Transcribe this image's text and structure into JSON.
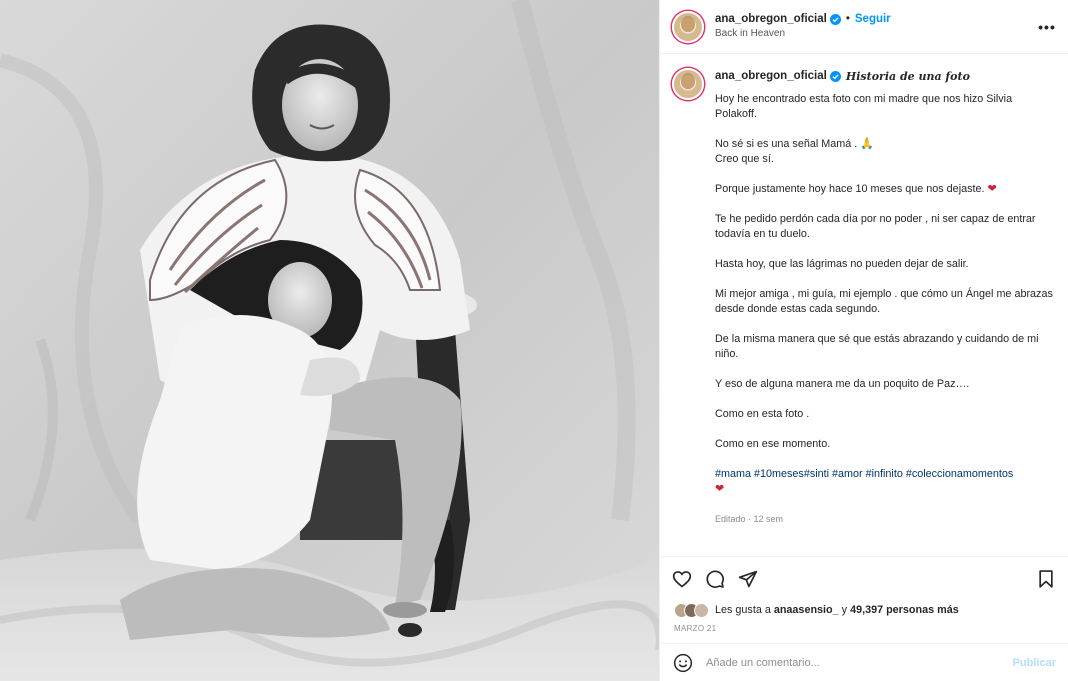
{
  "header": {
    "username": "ana_obregon_oficial",
    "follow_label": "Seguir",
    "dot": "•",
    "location": "Back in Heaven",
    "more_label": "•••"
  },
  "caption": {
    "username": "ana_obregon_oficial",
    "title": "Historia de una foto",
    "paragraphs": [
      "Hoy he encontrado esta foto con mi madre que nos hizo Silvia Polakoff.",
      "No sé si es una señal Mamá .",
      "Creo que sí.",
      "Porque justamente hoy hace 10 meses que nos dejaste.",
      "Te he pedido perdón cada día por no poder , ni ser capaz de entrar todavía en tu duelo.",
      "Hasta hoy, que las lágrimas no pueden dejar de salir.",
      "Mi mejor amiga , mi guía, mi ejemplo . que cómo un Ángel me abrazas desde donde estas cada segundo.",
      "De la misma manera que sé que estás abrazando y cuidando de mi niño.",
      "Y eso de alguna manera me da un poquito de Paz….",
      "Como en esta foto .",
      "Como en ese momento."
    ],
    "pray_emoji": "🙏",
    "heart": "❤",
    "hashtags": "#mama #10meses#sinti #amor #infinito #coleccionamomentos",
    "edited": "Editado · 12 sem"
  },
  "likes": {
    "prefix": "Les gusta a",
    "user": "anaasensio_",
    "middle": "y",
    "count": "49,397 personas más"
  },
  "date": "MARZO 21",
  "comment": {
    "placeholder": "Añade un comentario...",
    "publish_label": "Publicar"
  },
  "icons": {
    "like": "heart-icon",
    "comment": "comment-icon",
    "share": "share-icon",
    "save": "bookmark-icon",
    "emoji": "emoji-icon",
    "verified": "verified-badge-icon"
  },
  "colors": {
    "link": "#0095f6",
    "hashtag": "#00376b",
    "muted": "#8e8e8e",
    "publish_disabled": "#b2dffc"
  }
}
